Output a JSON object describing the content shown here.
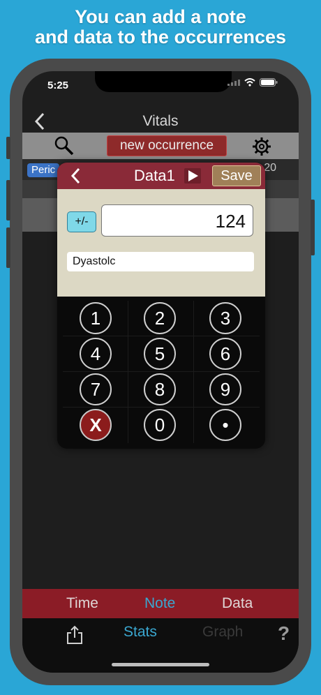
{
  "headline": {
    "line1": "You can add a note",
    "line2": "and data to the occurrences"
  },
  "status": {
    "time": "5:25"
  },
  "nav": {
    "title": "Vitals"
  },
  "toolbar": {
    "new_occurrence_label": "new occurrence"
  },
  "list": {
    "badge_label": "Peric",
    "row_value": "20"
  },
  "modal": {
    "title": "Data1",
    "save_label": "Save",
    "sign_toggle_label": "+/-",
    "value": "124",
    "label_value": "Dyastolc"
  },
  "keypad": {
    "keys": [
      "1",
      "2",
      "3",
      "4",
      "5",
      "6",
      "7",
      "8",
      "9",
      "X",
      "0",
      "•"
    ]
  },
  "segment": {
    "items": [
      "Time",
      "Note",
      "Data"
    ],
    "selected": "Note"
  },
  "tabbar": {
    "items": [
      "Stats",
      "Graph"
    ],
    "selected": "Stats",
    "help_label": "?"
  },
  "colors": {
    "background": "#2aa6d6",
    "modal_header": "#8a2a38",
    "segment_bar": "#8b1c26",
    "accent_selected": "#3aa7d0",
    "new_occurrence_button": "#8e2a2a"
  }
}
